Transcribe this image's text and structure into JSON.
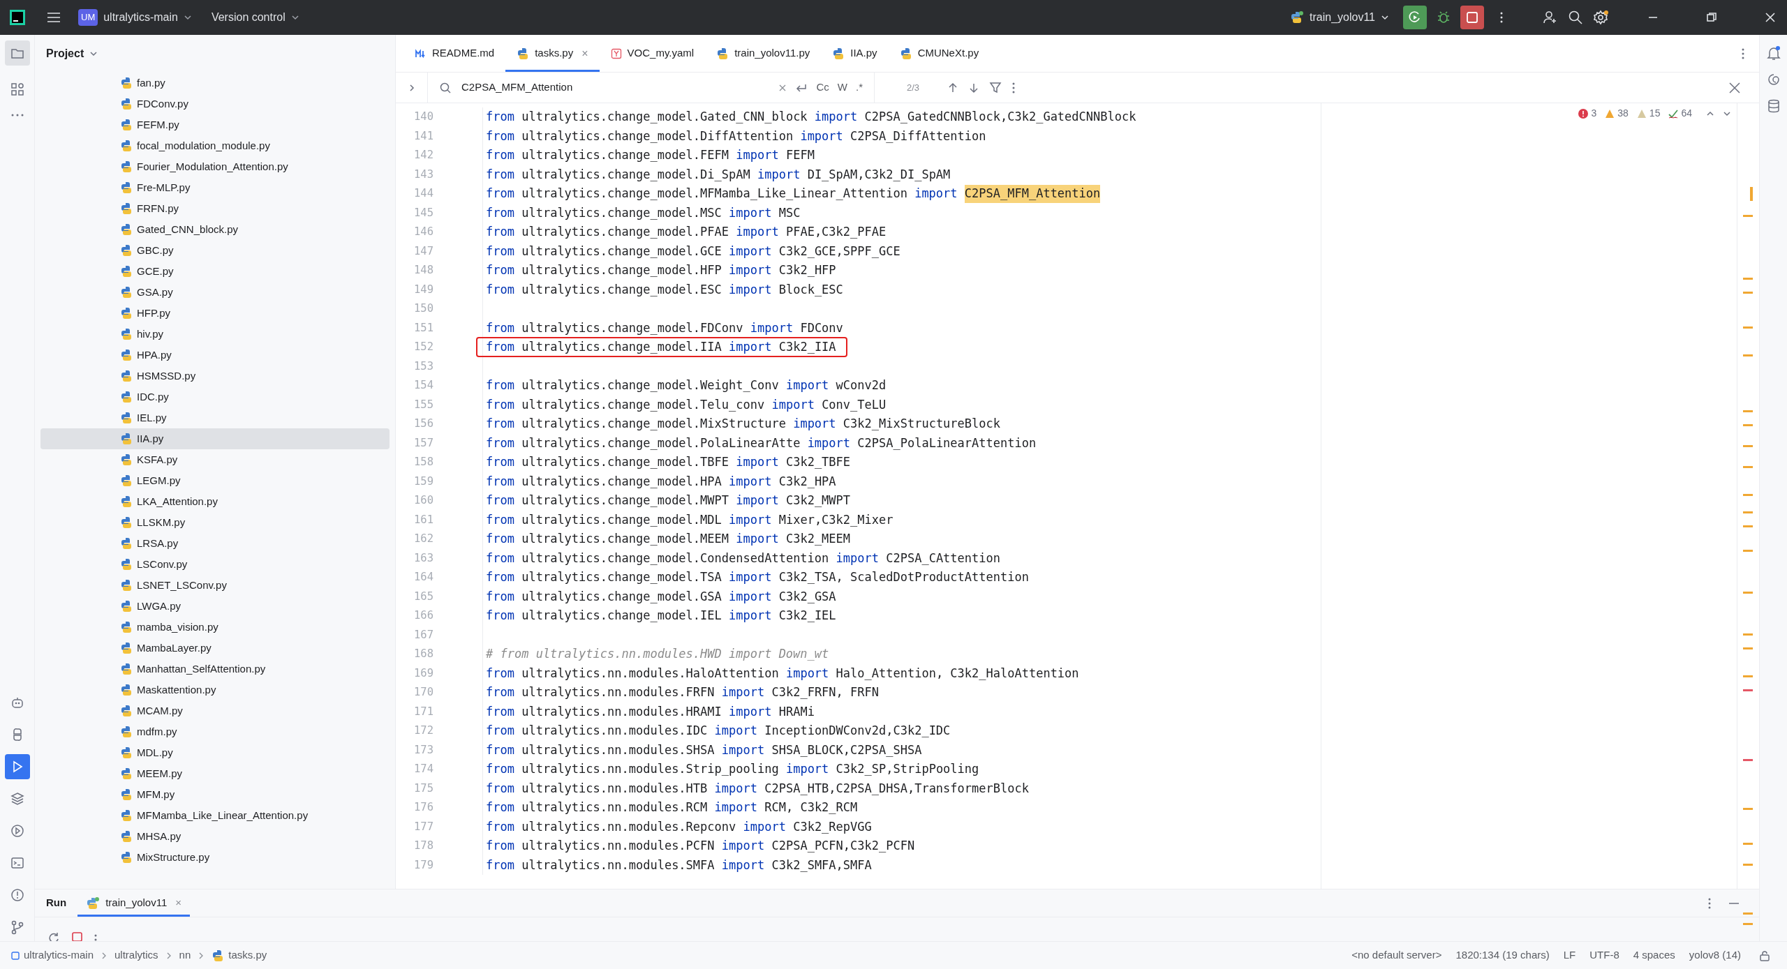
{
  "title_bar": {
    "project_badge": "UM",
    "project": "ultralytics-main",
    "vcs": "Version control",
    "run_config": "train_yolov11"
  },
  "project_panel": {
    "title": "Project",
    "files": [
      {
        "name": "fan.py",
        "selected": false
      },
      {
        "name": "FDConv.py",
        "selected": false
      },
      {
        "name": "FEFM.py",
        "selected": false
      },
      {
        "name": "focal_modulation_module.py",
        "selected": false
      },
      {
        "name": "Fourier_Modulation_Attention.py",
        "selected": false
      },
      {
        "name": "Fre-MLP.py",
        "selected": false
      },
      {
        "name": "FRFN.py",
        "selected": false
      },
      {
        "name": "Gated_CNN_block.py",
        "selected": false
      },
      {
        "name": "GBC.py",
        "selected": false
      },
      {
        "name": "GCE.py",
        "selected": false
      },
      {
        "name": "GSA.py",
        "selected": false
      },
      {
        "name": "HFP.py",
        "selected": false
      },
      {
        "name": "hiv.py",
        "selected": false
      },
      {
        "name": "HPA.py",
        "selected": false
      },
      {
        "name": "HSMSSD.py",
        "selected": false
      },
      {
        "name": "IDC.py",
        "selected": false
      },
      {
        "name": "IEL.py",
        "selected": false
      },
      {
        "name": "IIA.py",
        "selected": true
      },
      {
        "name": "KSFA.py",
        "selected": false
      },
      {
        "name": "LEGM.py",
        "selected": false
      },
      {
        "name": "LKA_Attention.py",
        "selected": false
      },
      {
        "name": "LLSKM.py",
        "selected": false
      },
      {
        "name": "LRSA.py",
        "selected": false
      },
      {
        "name": "LSConv.py",
        "selected": false
      },
      {
        "name": "LSNET_LSConv.py",
        "selected": false
      },
      {
        "name": "LWGA.py",
        "selected": false
      },
      {
        "name": "mamba_vision.py",
        "selected": false
      },
      {
        "name": "MambaLayer.py",
        "selected": false
      },
      {
        "name": "Manhattan_SelfAttention.py",
        "selected": false
      },
      {
        "name": "Maskattention.py",
        "selected": false
      },
      {
        "name": "MCAM.py",
        "selected": false
      },
      {
        "name": "mdfm.py",
        "selected": false
      },
      {
        "name": "MDL.py",
        "selected": false
      },
      {
        "name": "MEEM.py",
        "selected": false
      },
      {
        "name": "MFM.py",
        "selected": false
      },
      {
        "name": "MFMamba_Like_Linear_Attention.py",
        "selected": false
      },
      {
        "name": "MHSA.py",
        "selected": false
      },
      {
        "name": "MixStructure.py",
        "selected": false
      }
    ]
  },
  "tabs": [
    {
      "label": "README.md",
      "kind": "markdown",
      "selected": false
    },
    {
      "label": "tasks.py",
      "kind": "python",
      "selected": true,
      "close": "×"
    },
    {
      "label": "VOC_my.yaml",
      "kind": "yaml",
      "selected": false
    },
    {
      "label": "train_yolov11.py",
      "kind": "python",
      "selected": false
    },
    {
      "label": "IIA.py",
      "kind": "python",
      "selected": false
    },
    {
      "label": "CMUNeXt.py",
      "kind": "python",
      "selected": false
    }
  ],
  "find_bar": {
    "value": "C2PSA_MFM_Attention",
    "case": "Cc",
    "words": "W",
    "regex": ".*",
    "count": "2/3"
  },
  "inspections": {
    "errors": "3",
    "warnings": "38",
    "weak_warnings": "15",
    "typos": "64"
  },
  "code_lines": [
    {
      "number": "140",
      "kind": "import",
      "from": "from",
      "module": "ultralytics.change_model.Gated_CNN_block",
      "import": "import",
      "names": "C2PSA_GatedCNNBlock,C3k2_GatedCNNBlock",
      "match": false,
      "boxed": false
    },
    {
      "number": "141",
      "kind": "import",
      "from": "from",
      "module": "ultralytics.change_model.DiffAttention",
      "import": "import",
      "names": "C2PSA_DiffAttention",
      "match": false,
      "boxed": false
    },
    {
      "number": "142",
      "kind": "import",
      "from": "from",
      "module": "ultralytics.change_model.FEFM",
      "import": "import",
      "names": "FEFM",
      "match": false,
      "boxed": false
    },
    {
      "number": "143",
      "kind": "import",
      "from": "from",
      "module": "ultralytics.change_model.Di_SpAM",
      "import": "import",
      "names": "DI_SpAM,C3k2_DI_SpAM",
      "match": false,
      "boxed": false
    },
    {
      "number": "144",
      "kind": "import",
      "from": "from",
      "module": "ultralytics.change_model.MFMamba_Like_Linear_Attention",
      "import": "import",
      "names": "C2PSA_MFM_Attention",
      "match": true,
      "boxed": false
    },
    {
      "number": "145",
      "kind": "import",
      "from": "from",
      "module": "ultralytics.change_model.MSC",
      "import": "import",
      "names": "MSC",
      "match": false,
      "boxed": false
    },
    {
      "number": "146",
      "kind": "import",
      "from": "from",
      "module": "ultralytics.change_model.PFAE",
      "import": "import",
      "names": "PFAE,C3k2_PFAE",
      "match": false,
      "boxed": false
    },
    {
      "number": "147",
      "kind": "import",
      "from": "from",
      "module": "ultralytics.change_model.GCE",
      "import": "import",
      "names": "C3k2_GCE,SPPF_GCE",
      "match": false,
      "boxed": false
    },
    {
      "number": "148",
      "kind": "import",
      "from": "from",
      "module": "ultralytics.change_model.HFP",
      "import": "import",
      "names": "C3k2_HFP",
      "match": false,
      "boxed": false
    },
    {
      "number": "149",
      "kind": "import",
      "from": "from",
      "module": "ultralytics.change_model.ESC",
      "import": "import",
      "names": "Block_ESC",
      "match": false,
      "boxed": false
    },
    {
      "number": "150",
      "kind": "blank"
    },
    {
      "number": "151",
      "kind": "import",
      "from": "from",
      "module": "ultralytics.change_model.FDConv",
      "import": "import",
      "names": "FDConv",
      "match": false,
      "boxed": false
    },
    {
      "number": "152",
      "kind": "import",
      "from": "from",
      "module": "ultralytics.change_model.IIA",
      "import": "import",
      "names": "C3k2_IIA",
      "match": false,
      "boxed": true
    },
    {
      "number": "153",
      "kind": "blank"
    },
    {
      "number": "154",
      "kind": "import",
      "from": "from",
      "module": "ultralytics.change_model.Weight_Conv",
      "import": "import",
      "names": "wConv2d",
      "match": false,
      "boxed": false
    },
    {
      "number": "155",
      "kind": "import",
      "from": "from",
      "module": "ultralytics.change_model.Telu_conv",
      "import": "import",
      "names": "Conv_TeLU",
      "match": false,
      "boxed": false
    },
    {
      "number": "156",
      "kind": "import",
      "from": "from",
      "module": "ultralytics.change_model.MixStructure",
      "import": "import",
      "names": "C3k2_MixStructureBlock",
      "match": false,
      "boxed": false
    },
    {
      "number": "157",
      "kind": "import",
      "from": "from",
      "module": "ultralytics.change_model.PolaLinearAtte",
      "import": "import",
      "names": "C2PSA_PolaLinearAttention",
      "match": false,
      "boxed": false
    },
    {
      "number": "158",
      "kind": "import",
      "from": "from",
      "module": "ultralytics.change_model.TBFE",
      "import": "import",
      "names": "C3k2_TBFE",
      "match": false,
      "boxed": false
    },
    {
      "number": "159",
      "kind": "import",
      "from": "from",
      "module": "ultralytics.change_model.HPA",
      "import": "import",
      "names": "C3k2_HPA",
      "match": false,
      "boxed": false
    },
    {
      "number": "160",
      "kind": "import",
      "from": "from",
      "module": "ultralytics.change_model.MWPT",
      "import": "import",
      "names": "C3k2_MWPT",
      "match": false,
      "boxed": false
    },
    {
      "number": "161",
      "kind": "import",
      "from": "from",
      "module": "ultralytics.change_model.MDL",
      "import": "import",
      "names": "Mixer,C3k2_Mixer",
      "match": false,
      "boxed": false
    },
    {
      "number": "162",
      "kind": "import",
      "from": "from",
      "module": "ultralytics.change_model.MEEM",
      "import": "import",
      "names": "C3k2_MEEM",
      "match": false,
      "boxed": false
    },
    {
      "number": "163",
      "kind": "import",
      "from": "from",
      "module": "ultralytics.change_model.CondensedAttention",
      "import": "import",
      "names": "C2PSA_CAttention",
      "match": false,
      "boxed": false
    },
    {
      "number": "164",
      "kind": "import",
      "from": "from",
      "module": "ultralytics.change_model.TSA",
      "import": "import",
      "names": "C3k2_TSA, ScaledDotProductAttention",
      "match": false,
      "boxed": false
    },
    {
      "number": "165",
      "kind": "import",
      "from": "from",
      "module": "ultralytics.change_model.GSA",
      "import": "import",
      "names": "C3k2_GSA",
      "match": false,
      "boxed": false
    },
    {
      "number": "166",
      "kind": "import",
      "from": "from",
      "module": "ultralytics.change_model.IEL",
      "import": "import",
      "names": "C3k2_IEL",
      "match": false,
      "boxed": false
    },
    {
      "number": "167",
      "kind": "blank"
    },
    {
      "number": "168",
      "kind": "comment",
      "text": "# from ultralytics.nn.modules.HWD import Down_wt"
    },
    {
      "number": "169",
      "kind": "import",
      "from": "from",
      "module": "ultralytics.nn.modules.HaloAttention",
      "import": "import",
      "names": "Halo_Attention, C3k2_HaloAttention",
      "match": false,
      "boxed": false
    },
    {
      "number": "170",
      "kind": "import",
      "from": "from",
      "module": "ultralytics.nn.modules.FRFN",
      "import": "import",
      "names": "C3k2_FRFN, FRFN",
      "match": false,
      "boxed": false
    },
    {
      "number": "171",
      "kind": "import",
      "from": "from",
      "module": "ultralytics.nn.modules.HRAMI",
      "import": "import",
      "names": "HRAMi",
      "match": false,
      "boxed": false
    },
    {
      "number": "172",
      "kind": "import",
      "from": "from",
      "module": "ultralytics.nn.modules.IDC",
      "import": "import",
      "names": "InceptionDWConv2d,C3k2_IDC",
      "match": false,
      "boxed": false
    },
    {
      "number": "173",
      "kind": "import",
      "from": "from",
      "module": "ultralytics.nn.modules.SHSA",
      "import": "import",
      "names": "SHSA_BLOCK,C2PSA_SHSA",
      "match": false,
      "boxed": false
    },
    {
      "number": "174",
      "kind": "import",
      "from": "from",
      "module": "ultralytics.nn.modules.Strip_pooling",
      "import": "import",
      "names": "C3k2_SP,StripPooling",
      "match": false,
      "boxed": false
    },
    {
      "number": "175",
      "kind": "import",
      "from": "from",
      "module": "ultralytics.nn.modules.HTB",
      "import": "import",
      "names": "C2PSA_HTB,C2PSA_DHSA,TransformerBlock",
      "match": false,
      "boxed": false
    },
    {
      "number": "176",
      "kind": "import",
      "from": "from",
      "module": "ultralytics.nn.modules.RCM",
      "import": "import",
      "names": "RCM, C3k2_RCM",
      "match": false,
      "boxed": false
    },
    {
      "number": "177",
      "kind": "import",
      "from": "from",
      "module": "ultralytics.nn.modules.Repconv",
      "import": "import",
      "names": "C3k2_RepVGG",
      "match": false,
      "boxed": false
    },
    {
      "number": "178",
      "kind": "import",
      "from": "from",
      "module": "ultralytics.nn.modules.PCFN",
      "import": "import",
      "names": "C2PSA_PCFN,C3k2_PCFN",
      "match": false,
      "boxed": false
    },
    {
      "number": "179",
      "kind": "import",
      "from": "from",
      "module": "ultralytics.nn.modules.SMFA",
      "import": "import",
      "names": "C3k2_SMFA,SMFA",
      "match": false,
      "boxed": false
    }
  ],
  "run_panel": {
    "title": "Run",
    "tabs": [
      {
        "label": "train_yolov11",
        "selected": true,
        "close": "×"
      }
    ]
  },
  "status_bar": {
    "breadcrumbs": [
      "ultralytics-main",
      "ultralytics",
      "nn",
      "tasks.py"
    ],
    "items": [
      "<no default server>",
      "1820:134 (19 chars)",
      "LF",
      "UTF-8",
      "4 spaces",
      "yolov8 (14)"
    ]
  }
}
